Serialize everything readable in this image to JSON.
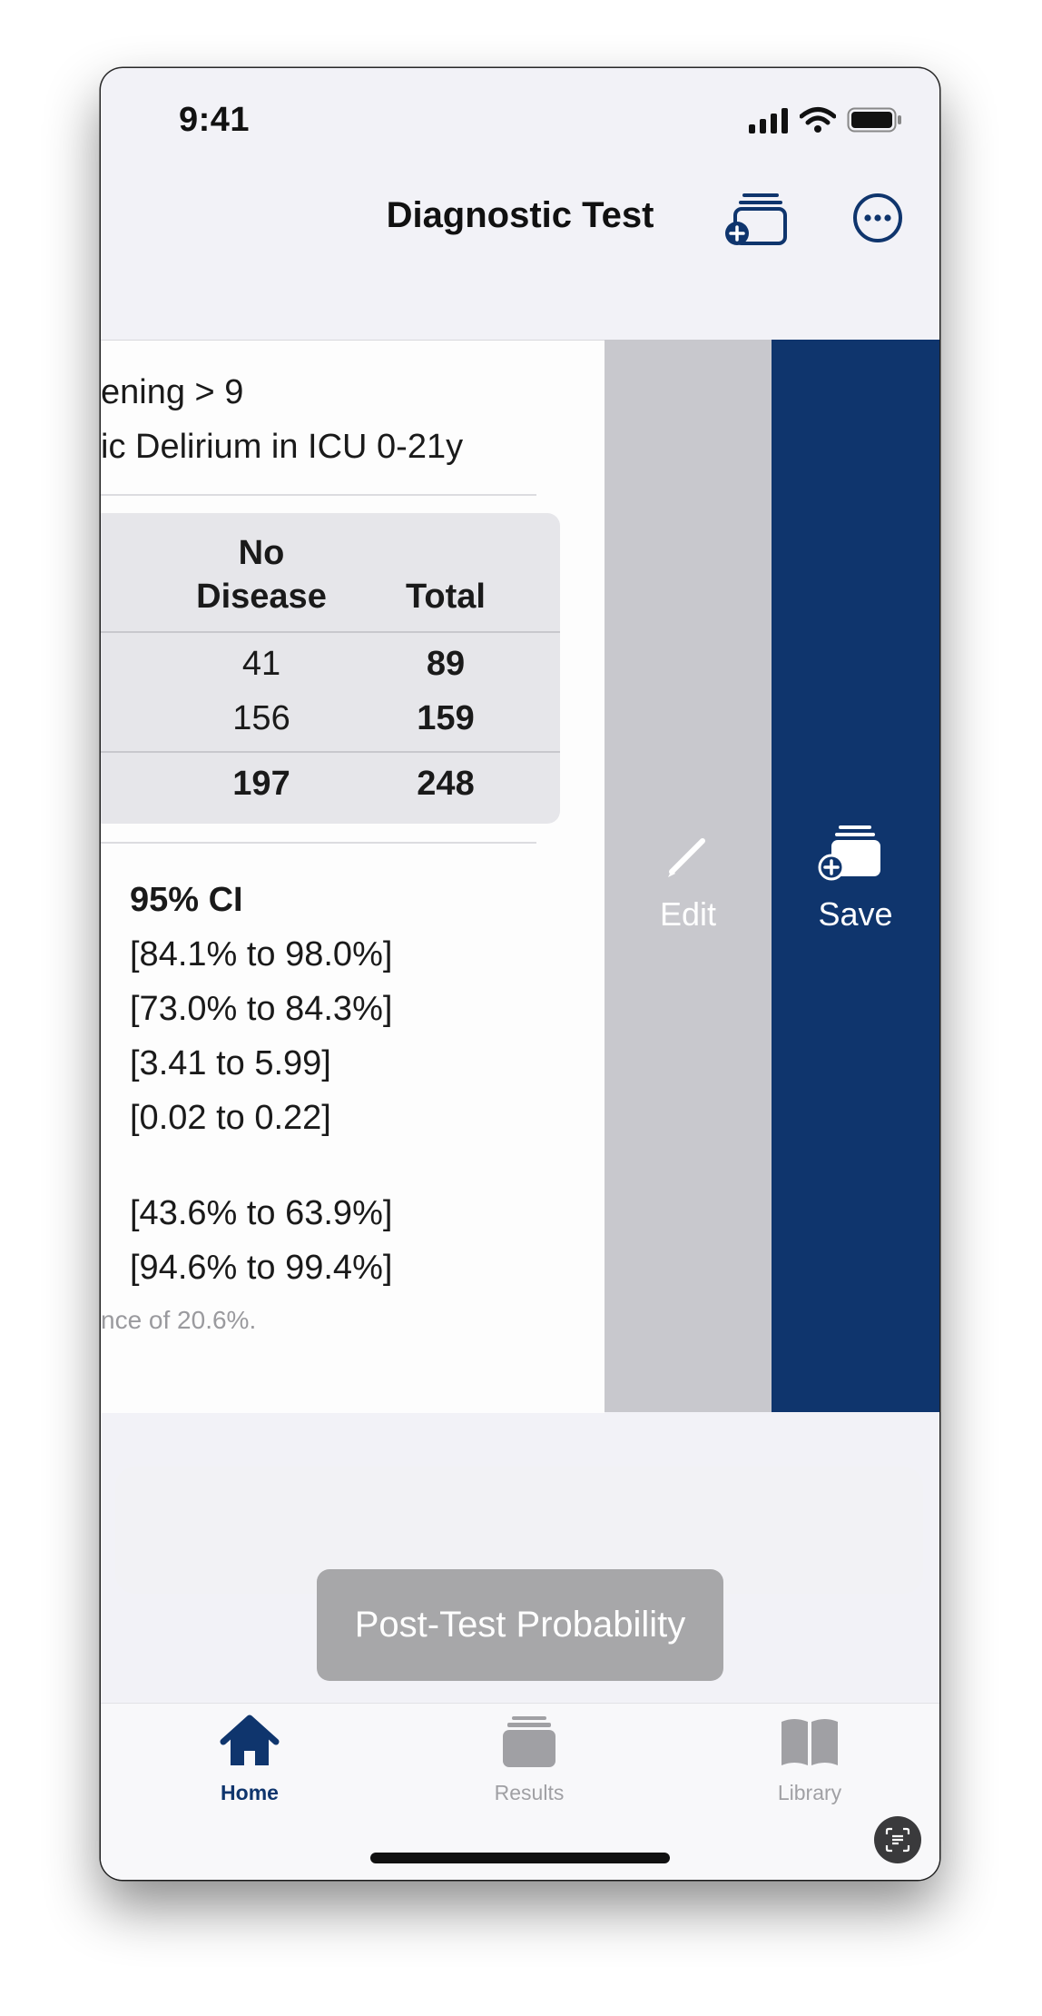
{
  "status_bar": {
    "time": "9:41"
  },
  "nav": {
    "title": "Diagnostic Test"
  },
  "card": {
    "line1": "ening > 9",
    "line2": "ic Delirium in ICU 0-21y",
    "table": {
      "header_no_disease": [
        "No",
        "Disease"
      ],
      "header_total": "Total",
      "rows": [
        {
          "no_disease": "41",
          "total": "89"
        },
        {
          "no_disease": "156",
          "total": "159"
        }
      ],
      "totals": {
        "no_disease": "197",
        "total": "248"
      }
    },
    "ci_header": "95% CI",
    "ci_values": [
      "[84.1% to 98.0%]",
      "[73.0% to 84.3%]",
      "[3.41 to 5.99]",
      "[0.02 to 0.22]"
    ],
    "ci_values_2": [
      "[43.6% to 63.9%]",
      "[94.6% to 99.4%]"
    ],
    "note": "nce of 20.6%."
  },
  "actions": {
    "edit": "Edit",
    "save": "Save"
  },
  "toast": {
    "label": "Post-Test Probability"
  },
  "tabs": [
    {
      "label": "Home",
      "active": true,
      "icon": "house-icon"
    },
    {
      "label": "Results",
      "active": false,
      "icon": "stack-icon"
    },
    {
      "label": "Library",
      "active": false,
      "icon": "book-icon"
    }
  ],
  "colors": {
    "accent": "#0f356d",
    "edit_bg": "#c8c8cd",
    "inactive": "#a0a0a4"
  }
}
